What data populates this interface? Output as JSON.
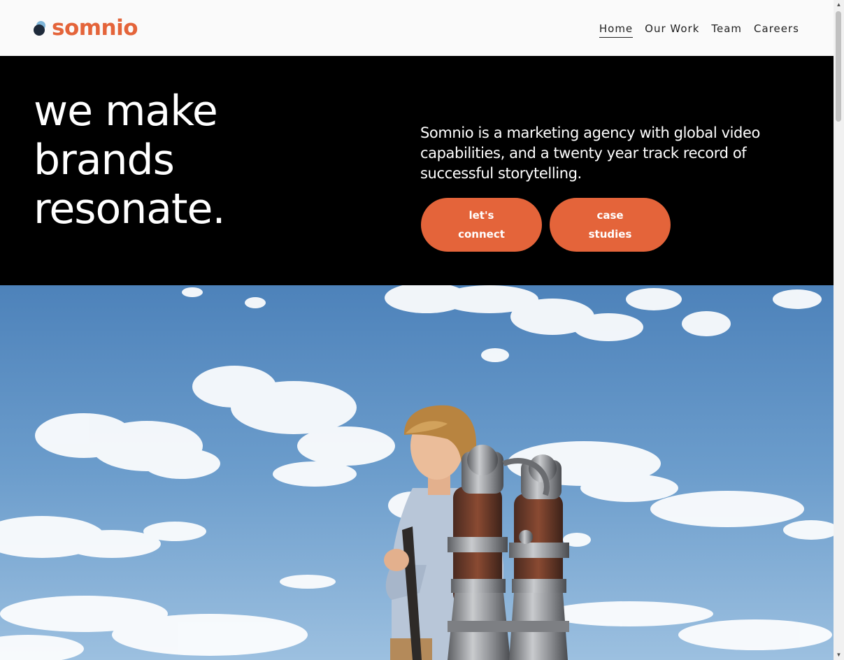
{
  "brand": {
    "name": "somnio",
    "accent_color": "#e4643a",
    "mark_icon": "logo-dots-icon"
  },
  "nav": {
    "items": [
      {
        "label": "Home",
        "active": true
      },
      {
        "label": "Our Work",
        "active": false
      },
      {
        "label": "Team",
        "active": false
      },
      {
        "label": "Careers",
        "active": false
      }
    ]
  },
  "hero": {
    "headline": "we make brands resonate.",
    "tagline": "Somnio is a marketing agency with global video capabilities, and a twenty year track record of successful storytelling.",
    "buttons": {
      "connect": "let's connect",
      "cases": "case studies"
    },
    "background": "#000000"
  },
  "photo": {
    "subject": "boy-with-jetpack-image"
  },
  "scrollbar": {
    "up_icon": "▲",
    "down_icon": "▼"
  }
}
